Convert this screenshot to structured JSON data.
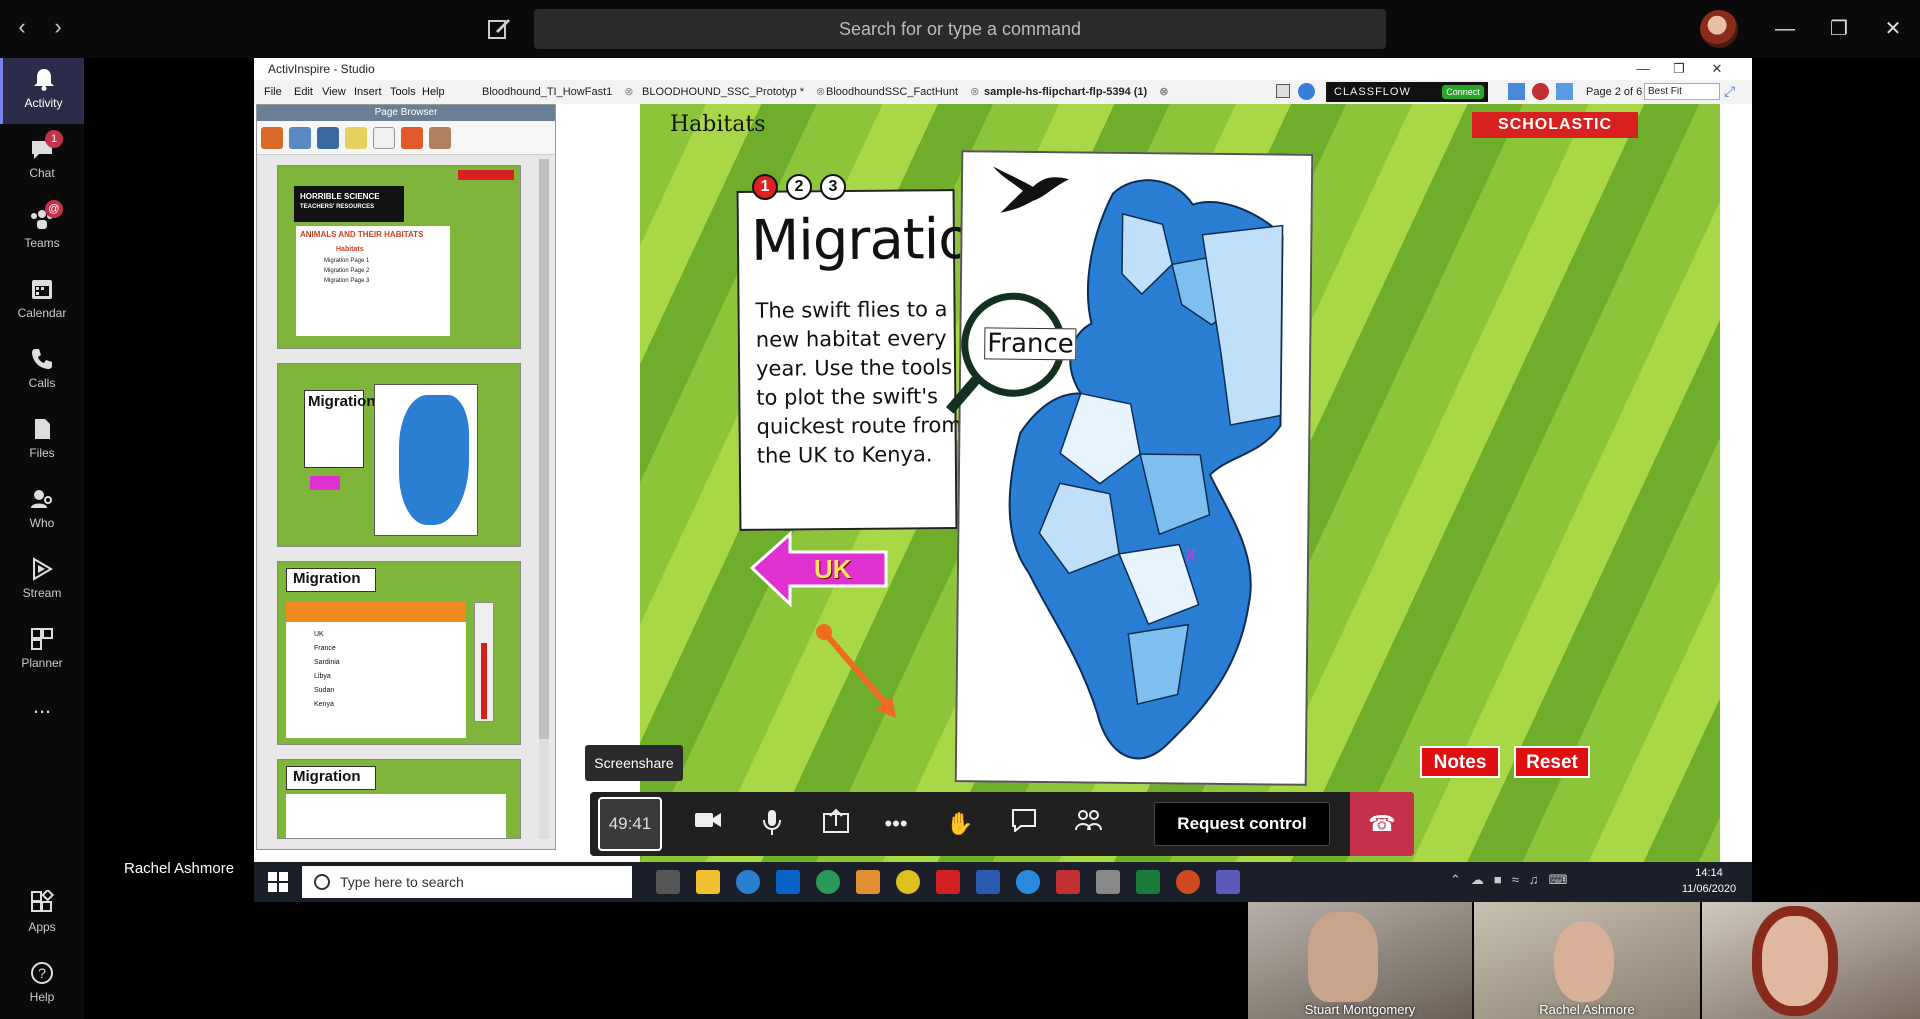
{
  "teams": {
    "search_placeholder": "Search for or type a command",
    "rail": [
      {
        "label": "Activity",
        "icon": "bell-icon",
        "active": true
      },
      {
        "label": "Chat",
        "icon": "chat-icon",
        "badge": "1"
      },
      {
        "label": "Teams",
        "icon": "teams-icon",
        "badge": "@"
      },
      {
        "label": "Calendar",
        "icon": "calendar-icon"
      },
      {
        "label": "Calls",
        "icon": "phone-icon"
      },
      {
        "label": "Files",
        "icon": "files-icon"
      },
      {
        "label": "Who",
        "icon": "who-icon"
      },
      {
        "label": "Stream",
        "icon": "stream-icon"
      },
      {
        "label": "Planner",
        "icon": "planner-icon"
      },
      {
        "label": "...",
        "icon": "more-icon"
      }
    ],
    "rail_bottom": [
      {
        "label": "Apps",
        "icon": "apps-icon"
      },
      {
        "label": "Help",
        "icon": "help-icon"
      }
    ],
    "presenter_name": "Rachel Ashmore",
    "tooltip": "Screenshare",
    "call_timer": "49:41",
    "request_control": "Request control",
    "participants": [
      {
        "name": "Stuart Montgomery"
      },
      {
        "name": "Rachel Ashmore"
      },
      {
        "name": ""
      }
    ]
  },
  "activinspire": {
    "window_title": "ActivInspire - Studio",
    "menus": [
      "File",
      "Edit",
      "View",
      "Insert",
      "Tools",
      "Help"
    ],
    "doc_tabs": [
      {
        "label": "Bloodhound_TI_HowFast1"
      },
      {
        "label": "BLOODHOUND_SSC_Prototyp *"
      },
      {
        "label": "BloodhoundSSC_FactHunt"
      },
      {
        "label": "sample-hs-flipchart-flp-5394 (1)",
        "current": true
      }
    ],
    "classflow_label": "CLASSFLOW",
    "connect_label": "Connect",
    "page_info": "Page 2 of 6",
    "zoom": "Best Fit",
    "page_browser_title": "Page Browser",
    "thumbnails": [
      {
        "title": "ANIMALS AND THEIR HABITATS",
        "subtitle": "HORRIBLE SCIENCE",
        "sub2": "TEACHERS' RESOURCES",
        "items": [
          "Habitats",
          "Migration Page 1",
          "Migration Page 2",
          "Migration Page 3"
        ]
      },
      {
        "title": "Migration"
      },
      {
        "title": "Migration",
        "rows": [
          "UK",
          "France",
          "Sardinia",
          "Libya",
          "Sudan",
          "Kenya"
        ]
      },
      {
        "title": "Migration"
      }
    ]
  },
  "flipchart": {
    "section": "Habitats",
    "brand": "SCHOLASTIC",
    "steps": [
      "1",
      "2",
      "3"
    ],
    "title": "Migration",
    "body": "The swift flies to a new habitat every year. Use the tools to plot the swift's quickest route from the UK to Kenya.",
    "magnifier_label": "France",
    "uk_label": "UK",
    "notes_button": "Notes",
    "reset_button": "Reset",
    "colors": {
      "brand_red": "#d92020",
      "green": "#8cc43a",
      "map_blue": "#2a7fd4"
    }
  },
  "taskbar": {
    "search_placeholder": "Type here to search",
    "time": "14:14",
    "date": "11/06/2020"
  }
}
